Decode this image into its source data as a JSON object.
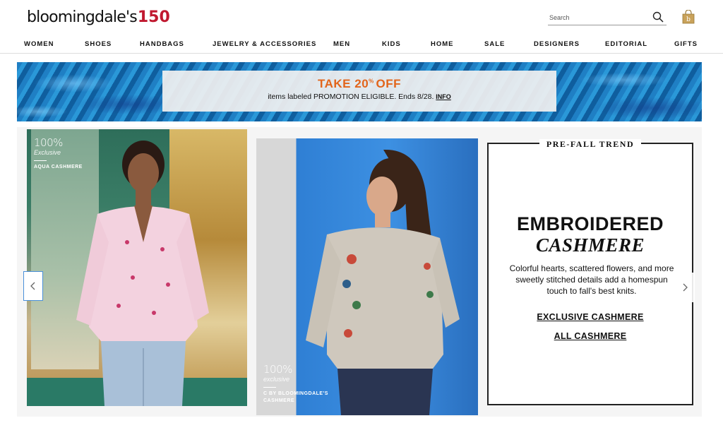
{
  "header": {
    "logo_text": "bloomingdale's",
    "logo_number": "150",
    "search_placeholder": "Search"
  },
  "nav": {
    "items": [
      "WOMEN",
      "SHOES",
      "HANDBAGS",
      "JEWELRY & ACCESSORIES",
      "MEN",
      "KIDS",
      "HOME",
      "SALE",
      "DESIGNERS",
      "EDITORIAL",
      "GIFTS"
    ]
  },
  "promo": {
    "title": "TAKE 20",
    "title_suffix": "% ",
    "title_end": "OFF",
    "subtitle": "items labeled PROMOTION ELIGIBLE. Ends 8/28.",
    "info_link": "INFO",
    "accent_color": "#e2651b"
  },
  "carousel": {
    "card1": {
      "badge_number": "100%",
      "badge_word": "Exclusive",
      "badge_brand": "AQUA CASHMERE"
    },
    "card2": {
      "badge_number": "100%",
      "badge_word": "exclusive",
      "badge_brand_line1": "C BY BLOOMINGDALE'S",
      "badge_brand_line2": "CASHMERE"
    },
    "card3": {
      "kicker": "PRE-FALL TREND",
      "title_line1": "EMBROIDERED",
      "title_line2": "CASHMERE",
      "body": "Colorful hearts, scattered flowers, and more sweetly stitched details add a homespun touch to fall's best knits.",
      "link1": "EXCLUSIVE CASHMERE",
      "link2": "ALL CASHMERE"
    },
    "prev_icon": "chevron-left-icon",
    "next_icon": "chevron-right-icon"
  }
}
